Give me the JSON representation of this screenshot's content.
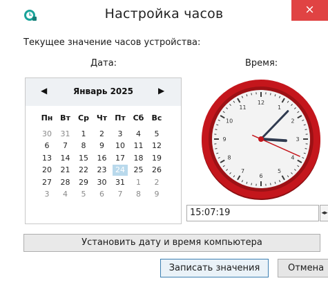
{
  "window": {
    "title": "Настройка часов",
    "close_glyph": "×"
  },
  "caption": "Текущее значение часов устройства:",
  "date_label": "Дата:",
  "time_label": "Время:",
  "calendar": {
    "month_label": "Январь 2025",
    "prev_glyph": "◀",
    "next_glyph": "▶",
    "weekdays": [
      "Пн",
      "Вт",
      "Ср",
      "Чт",
      "Пт",
      "Сб",
      "Вс"
    ],
    "weeks": [
      [
        "30",
        "31",
        "1",
        "2",
        "3",
        "4",
        "5"
      ],
      [
        "6",
        "7",
        "8",
        "9",
        "10",
        "11",
        "12"
      ],
      [
        "13",
        "14",
        "15",
        "16",
        "17",
        "18",
        "19"
      ],
      [
        "20",
        "21",
        "22",
        "23",
        "24",
        "25",
        "26"
      ],
      [
        "27",
        "28",
        "29",
        "30",
        "31",
        "1",
        "2"
      ],
      [
        "3",
        "4",
        "5",
        "6",
        "7",
        "8",
        "9"
      ]
    ],
    "selected_day": "24"
  },
  "clock": {
    "numbers": [
      "12",
      "1",
      "2",
      "3",
      "4",
      "5",
      "6",
      "7",
      "8",
      "9",
      "10",
      "11"
    ],
    "time": {
      "hours": 15,
      "minutes": 7,
      "seconds": 19
    },
    "colors": {
      "rim": "#c4161c",
      "face": "#f3f3f3",
      "hands": "#2f3a4f",
      "second_hand": "#c4161c"
    }
  },
  "time_field": {
    "value": "15:07:19",
    "spin_glyph": "◂▸"
  },
  "buttons": {
    "sync_label": "Установить дату и время компьютера",
    "write_label": "Записать значения",
    "cancel_label": "Отмена"
  },
  "icons": {
    "app": "clock-app-icon",
    "close": "close-icon"
  }
}
